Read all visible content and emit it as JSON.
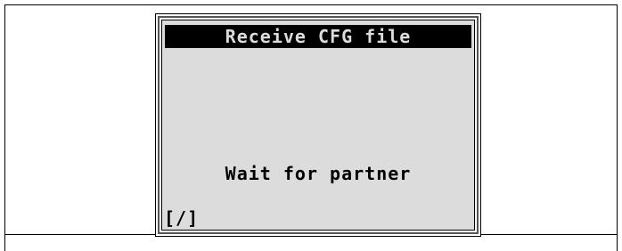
{
  "device": {
    "title": "Receive CFG file",
    "message": "Wait for partner",
    "spinner": "[/]"
  }
}
